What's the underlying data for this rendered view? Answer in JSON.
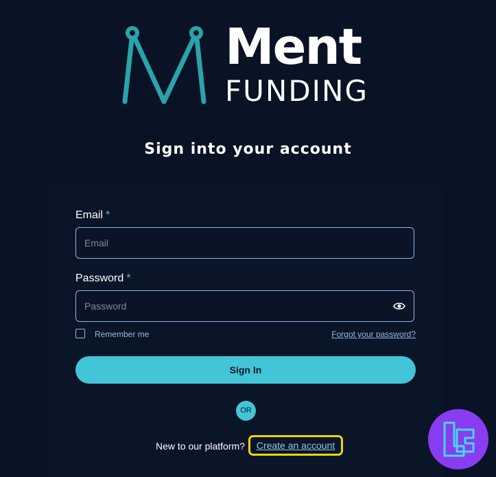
{
  "brand": {
    "name": "Ment",
    "tagline": "FUNDING",
    "accent": "#2aa3ab"
  },
  "page_title": "Sign into your account",
  "form": {
    "email": {
      "label": "Email",
      "required_marker": "*",
      "placeholder": "Email",
      "value": ""
    },
    "password": {
      "label": "Password",
      "required_marker": "*",
      "placeholder": "Password",
      "value": "",
      "toggle_icon": "eye-icon"
    },
    "remember_me": {
      "label": "Remember me",
      "checked": false
    },
    "forgot_password": "Forgot your password?",
    "submit": "Sign In",
    "divider": "OR"
  },
  "signup": {
    "prompt": "New to our platform?",
    "link": "Create an account"
  },
  "colors": {
    "background": "#091325",
    "button": "#43c5d8",
    "highlight": "#f5d312",
    "badge": "#8a3cf0"
  },
  "watermark": {
    "icon": "tc-logo-icon"
  }
}
